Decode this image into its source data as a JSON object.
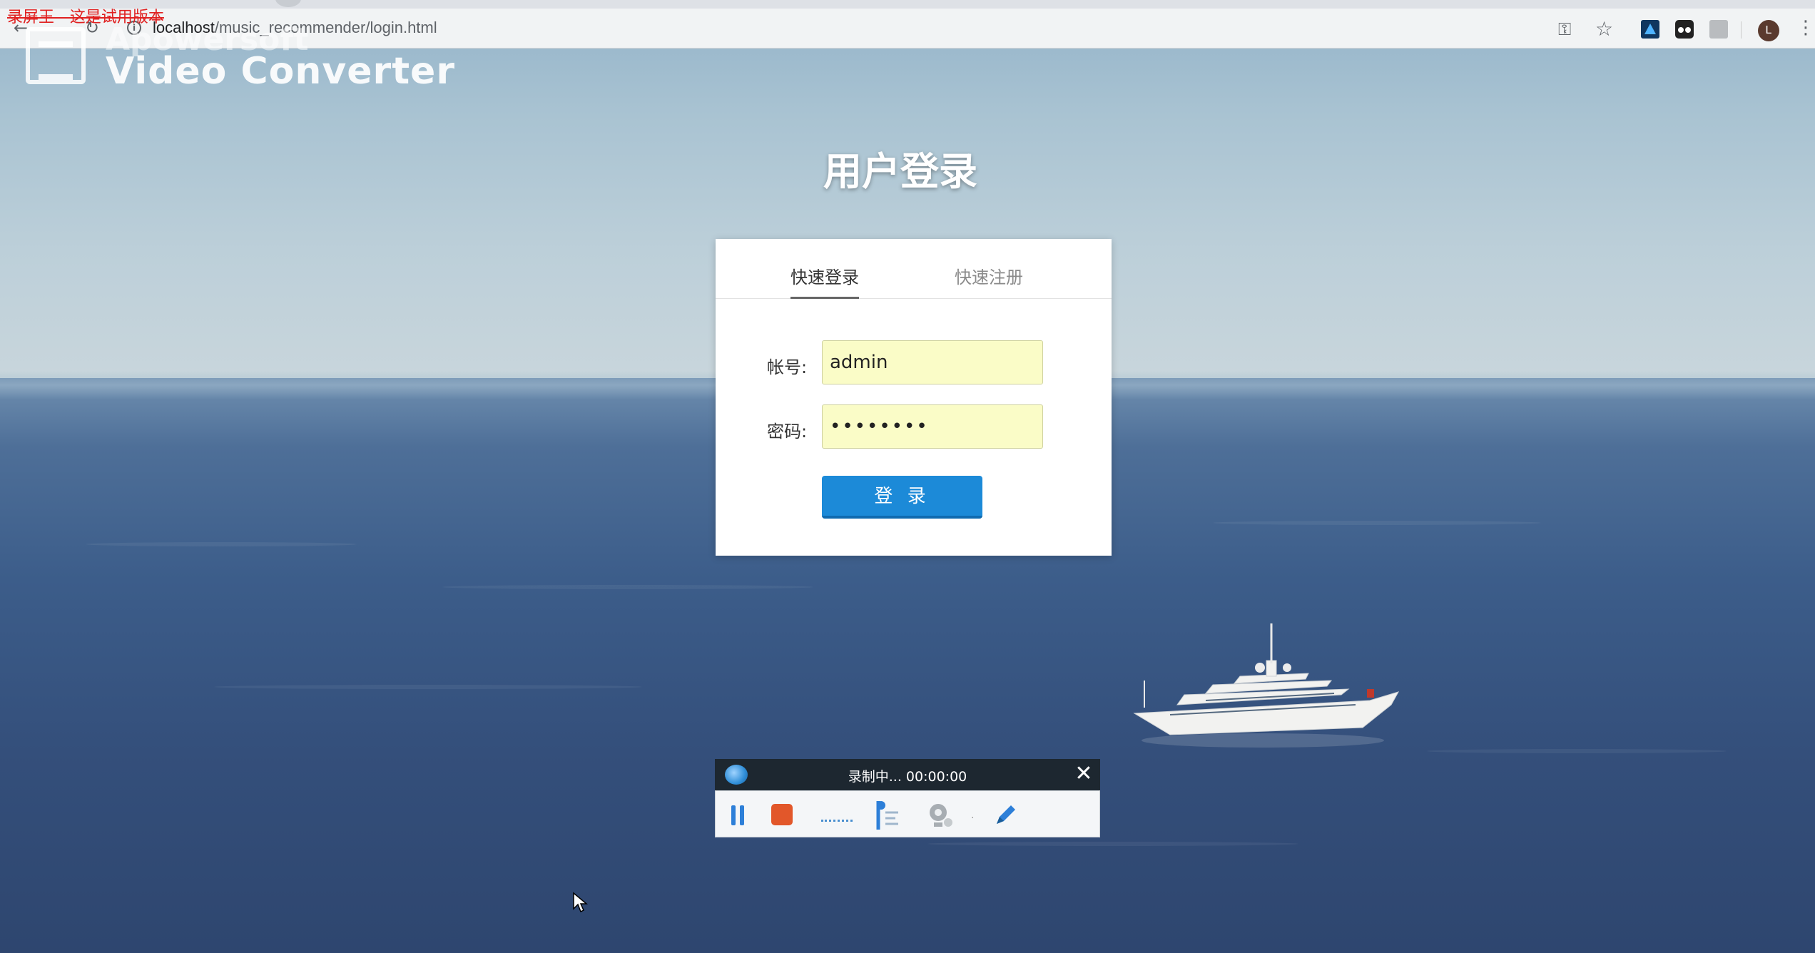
{
  "watermark": {
    "trial_text": "录屏王 - 这是试用版本",
    "converter_name_top": "Apowersoft",
    "converter_name": "Video Converter"
  },
  "browser": {
    "url_host": "localhost",
    "url_path": "/music_recommender/login.html",
    "avatar_letter": "L"
  },
  "page": {
    "title": "用户登录"
  },
  "login_card": {
    "tabs": [
      {
        "label": "快速登录",
        "active": true
      },
      {
        "label": "快速注册",
        "active": false
      }
    ],
    "account_label": "帐号:",
    "account_value": "admin",
    "password_label": "密码:",
    "password_value": "••••••••",
    "submit_label": "登 录"
  },
  "recorder": {
    "status": "录制中... 00:00:00"
  },
  "colors": {
    "accent_button": "#1c8ad8",
    "input_autofill": "#fafcc7",
    "trial_red": "#e02020",
    "recorder_stop": "#e2572a"
  },
  "icons": [
    "back-icon",
    "reload-icon",
    "info-icon",
    "key-icon",
    "star-icon",
    "extension-icon",
    "menu-icon",
    "camera-icon",
    "close-icon",
    "pause-icon",
    "stop-icon",
    "marker-icon",
    "webcam-icon",
    "pen-icon",
    "cursor-icon"
  ]
}
